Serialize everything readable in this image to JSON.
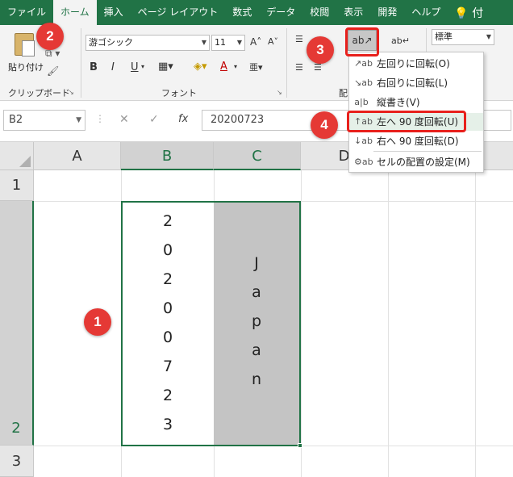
{
  "tabs": [
    "ファイル",
    "ホーム",
    "挿入",
    "ページ レイアウト",
    "数式",
    "データ",
    "校閲",
    "表示",
    "開発",
    "ヘルプ"
  ],
  "tab_extra": "💡 付",
  "ribbon": {
    "paste_label": "貼り付け",
    "clipboard_label": "クリップボード",
    "font_label": "フォント",
    "align_label": "配",
    "font_name": "游ゴシック",
    "font_size": "11",
    "grow_font": "A˄",
    "shrink_font": "A˅",
    "bold": "B",
    "italic": "I",
    "underline": "U",
    "font_color_letter": "A",
    "number_format": "標準",
    "orientation_button": "ab↗"
  },
  "name_box": "B2",
  "formula_value": "20200723",
  "fx_label": "fx",
  "columns": [
    "A",
    "B",
    "C",
    "D"
  ],
  "rows": [
    "1",
    "2",
    "3"
  ],
  "cells": {
    "B2_chars": [
      "2",
      "0",
      "2",
      "0",
      "0",
      "7",
      "2",
      "3"
    ],
    "C2_chars": [
      "J",
      "a",
      "p",
      "a",
      "n"
    ]
  },
  "menu": {
    "items": [
      {
        "label": "左回りに回転(O)",
        "icon": "↗ab"
      },
      {
        "label": "右回りに回転(L)",
        "icon": "↘ab"
      },
      {
        "label": "縦書き(V)",
        "icon": "a|b"
      },
      {
        "label": "左へ 90 度回転(U)",
        "icon": "↑ab"
      },
      {
        "label": "右へ 90 度回転(D)",
        "icon": "↓ab"
      },
      {
        "label": "セルの配置の設定(M)",
        "icon": "⚙ab"
      }
    ]
  },
  "badges": [
    "1",
    "2",
    "3",
    "4"
  ],
  "colors": {
    "excel_green": "#217346",
    "callout_red": "#e53935",
    "cell_fill": "#c4c4c4"
  }
}
